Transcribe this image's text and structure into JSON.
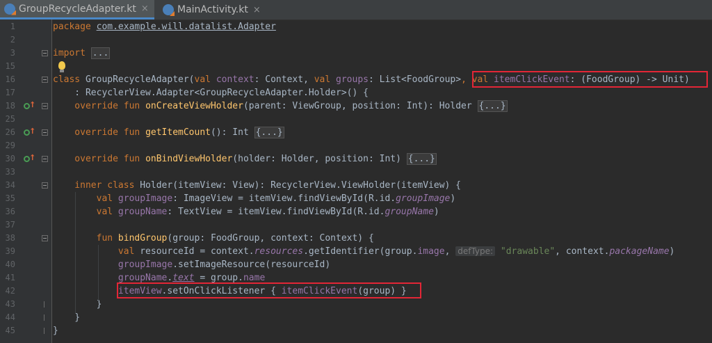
{
  "tabs": [
    {
      "label": "GroupRecycleAdapter.kt",
      "close": "×",
      "active": true
    },
    {
      "label": "MainActivity.kt",
      "close": "×",
      "active": false
    }
  ],
  "lines": [
    {
      "n": "1",
      "segs": [
        [
          "kw",
          "package "
        ],
        [
          "u",
          "com.example.will.datalist.Adapter"
        ]
      ]
    },
    {
      "n": "2",
      "segs": []
    },
    {
      "n": "3",
      "segs": [
        [
          "kw",
          "import "
        ],
        [
          "fold",
          "..."
        ]
      ]
    },
    {
      "n": "15",
      "segs": []
    },
    {
      "n": "16",
      "segs": [
        [
          "kw",
          "class "
        ],
        [
          "",
          "GroupRecycleAdapter("
        ],
        [
          "kw",
          "val "
        ],
        [
          "prop",
          "context"
        ],
        [
          "",
          ": Context, "
        ],
        [
          "kw",
          "val "
        ],
        [
          "prop",
          "groups"
        ],
        [
          "",
          ": List<FoodGroup>"
        ],
        [
          "kw",
          ", val "
        ],
        [
          "prop",
          "itemClickEvent"
        ],
        [
          "",
          ": (FoodGroup) -> Unit)"
        ]
      ]
    },
    {
      "n": "17",
      "segs": [
        [
          "",
          "    : RecyclerView.Adapter<GroupRecycleAdapter.Holder>() {"
        ]
      ]
    },
    {
      "n": "18",
      "segs": [
        [
          "kw",
          "    override fun "
        ],
        [
          "fn",
          "onCreateViewHolder"
        ],
        [
          "",
          "(parent: ViewGroup, position: Int): Holder "
        ],
        [
          "fold",
          "{...}"
        ]
      ]
    },
    {
      "n": "25",
      "segs": []
    },
    {
      "n": "26",
      "segs": [
        [
          "kw",
          "    override fun "
        ],
        [
          "fn",
          "getItemCount"
        ],
        [
          "",
          "(): Int "
        ],
        [
          "fold",
          "{...}"
        ]
      ]
    },
    {
      "n": "29",
      "segs": []
    },
    {
      "n": "30",
      "segs": [
        [
          "kw",
          "    override fun "
        ],
        [
          "fn",
          "onBindViewHolder"
        ],
        [
          "",
          "(holder: Holder, position: Int) "
        ],
        [
          "fold",
          "{...}"
        ]
      ]
    },
    {
      "n": "33",
      "segs": []
    },
    {
      "n": "34",
      "segs": [
        [
          "kw",
          "    inner class "
        ],
        [
          "",
          "Holder(itemView: View): RecyclerView.ViewHolder(itemView) {"
        ]
      ]
    },
    {
      "n": "35",
      "segs": [
        [
          "kw",
          "        val "
        ],
        [
          "prop",
          "groupImage"
        ],
        [
          "",
          ": ImageView = itemView.findViewById(R.id."
        ],
        [
          "propi",
          "groupImage"
        ],
        [
          "",
          ")"
        ]
      ]
    },
    {
      "n": "36",
      "segs": [
        [
          "kw",
          "        val "
        ],
        [
          "prop",
          "groupName"
        ],
        [
          "",
          ": TextView = itemView.findViewById(R.id."
        ],
        [
          "propi",
          "groupName"
        ],
        [
          "",
          ")"
        ]
      ]
    },
    {
      "n": "37",
      "segs": []
    },
    {
      "n": "38",
      "segs": [
        [
          "kw",
          "        fun "
        ],
        [
          "fn",
          "bindGroup"
        ],
        [
          "",
          "(group: FoodGroup, context: Context) {"
        ]
      ]
    },
    {
      "n": "39",
      "segs": [
        [
          "kw",
          "            val "
        ],
        [
          "",
          "resourceId = context."
        ],
        [
          "propi",
          "resources"
        ],
        [
          "",
          ".getIdentifier(group."
        ],
        [
          "prop",
          "image"
        ],
        [
          "",
          ", "
        ],
        [
          "hint",
          "defType:"
        ],
        [
          "str",
          " \"drawable\""
        ],
        [
          "",
          ", context."
        ],
        [
          "propi",
          "packageName"
        ],
        [
          "",
          ")"
        ]
      ]
    },
    {
      "n": "40",
      "segs": [
        [
          "prop",
          "            groupImage"
        ],
        [
          "",
          ".setImageResource(resourceId)"
        ]
      ]
    },
    {
      "n": "41",
      "segs": [
        [
          "prop",
          "            groupName"
        ],
        [
          "",
          "."
        ],
        [
          "propiu",
          "text"
        ],
        [
          "",
          " = group."
        ],
        [
          "prop",
          "name"
        ]
      ]
    },
    {
      "n": "42",
      "segs": [
        [
          "prop",
          "            itemView"
        ],
        [
          "",
          ".setOnClickListener { "
        ],
        [
          "prop",
          "itemClickEvent"
        ],
        [
          "",
          "(group) }"
        ]
      ]
    },
    {
      "n": "43",
      "segs": [
        [
          "",
          "        }"
        ]
      ]
    },
    {
      "n": "44",
      "segs": [
        [
          "",
          "    }"
        ]
      ]
    },
    {
      "n": "45",
      "segs": [
        [
          "",
          "}"
        ]
      ]
    }
  ],
  "gutter_markers": {
    "override_lines": [
      "18",
      "26",
      "30"
    ],
    "override_icon": "implements-icon",
    "override_arrow": "⭡",
    "bulb_line": "15"
  },
  "colors": {
    "background": "#2b2b2b",
    "keyword": "#cc7832",
    "function": "#ffc66d",
    "property": "#9876aa",
    "string": "#6a8759",
    "highlight_box": "#e32636"
  }
}
